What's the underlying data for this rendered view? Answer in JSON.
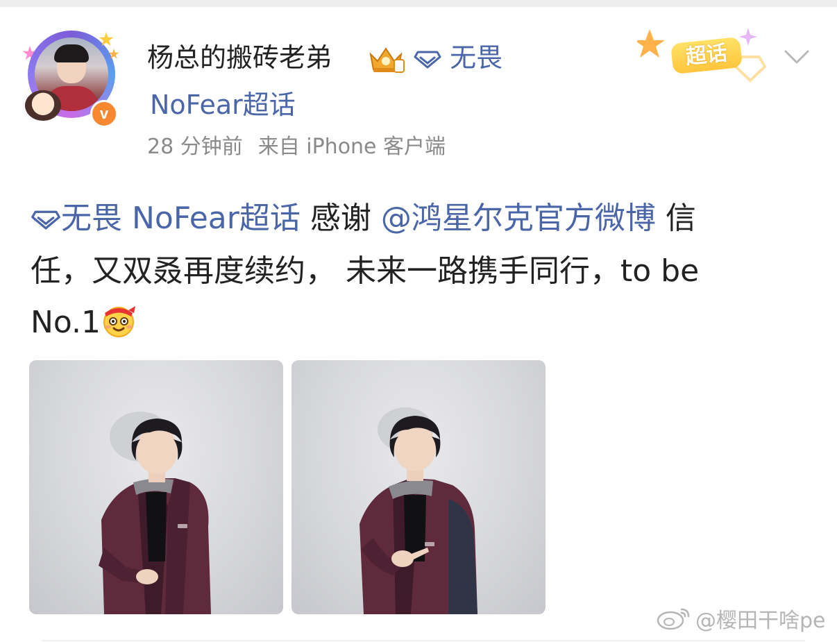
{
  "post": {
    "author": {
      "name": "杨总的搬砖老弟",
      "verified_badge": "v"
    },
    "supertopic": {
      "name": "无畏",
      "full_line2": "NoFear超话"
    },
    "meta": {
      "time": "28 分钟前",
      "source": "来自 iPhone 客户端"
    },
    "chaohua_badge_label": "超话",
    "content": {
      "topic": "无畏 NoFear超话",
      "thanks": " 感谢",
      "mention": "@鸿星尔克官方微博",
      "line1_end": " 信",
      "line2": "任，又双叒再度续约， 未来一路携手同行，to be",
      "line3": "No.1"
    },
    "photos": [
      {
        "name": "photo-1",
        "pose": "hand-forward"
      },
      {
        "name": "photo-2",
        "pose": "pointing-logo"
      }
    ],
    "watermark": "@樱田干啥pe"
  },
  "colors": {
    "link_blue": "#4a66a8",
    "text_dark": "#222222",
    "meta_gray": "#8a8a8a",
    "verified_orange": "#f7882f",
    "chaohua_yellow": "#ffc53d",
    "jacket_purple": "#5e2a3c"
  },
  "icons": {
    "crown": "crown-badge-icon",
    "diamond": "diamond-icon",
    "dropdown": "chevron-down-icon",
    "emoji": "cheering-emoji-icon",
    "weibo": "weibo-logo-icon"
  }
}
